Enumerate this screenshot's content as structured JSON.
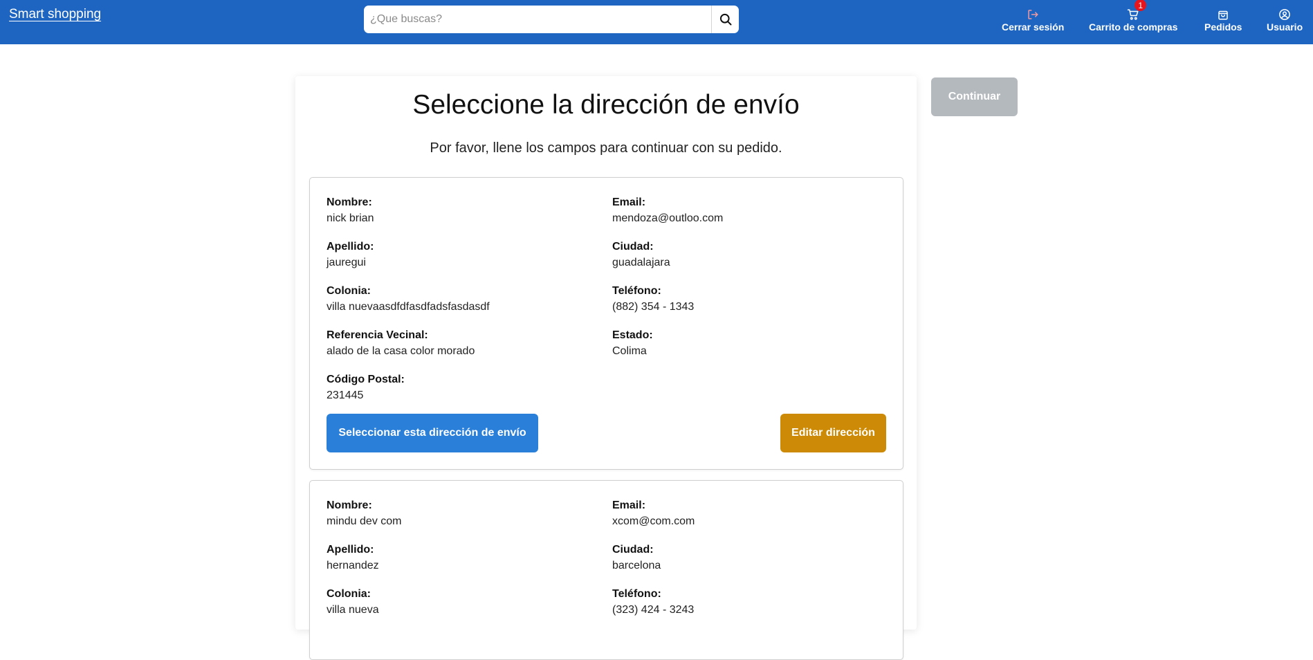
{
  "header": {
    "brand": "Smart shopping",
    "search": {
      "placeholder": "¿Que buscas?",
      "value": ""
    },
    "nav": {
      "logout": "Cerrar sesión",
      "cart": "Carrito de compras",
      "cart_count": "1",
      "orders": "Pedidos",
      "user": "Usuario"
    }
  },
  "page": {
    "title": "Seleccione la dirección de envío",
    "subtitle": "Por favor, llene los campos para continuar con su pedido.",
    "continue_label": "Continuar"
  },
  "addresses": [
    {
      "nombre": {
        "label": "Nombre:",
        "value": "nick brian"
      },
      "apellido": {
        "label": "Apellido:",
        "value": "jauregui"
      },
      "colonia": {
        "label": "Colonia:",
        "value": "villa nuevaasdfdfasdfadsfasdasdf"
      },
      "referencia": {
        "label": "Referencia Vecinal:",
        "value": "alado de la casa color morado"
      },
      "codigo_postal": {
        "label": "Código Postal:",
        "value": "231445"
      },
      "email": {
        "label": "Email:",
        "value": "mendoza@outloo.com"
      },
      "ciudad": {
        "label": "Ciudad:",
        "value": "guadalajara"
      },
      "telefono": {
        "label": "Teléfono:",
        "value": "(882) 354 - 1343"
      },
      "estado": {
        "label": "Estado:",
        "value": "Colima"
      },
      "select_label": "Seleccionar esta dirección de envío",
      "edit_label": "Editar dirección"
    },
    {
      "nombre": {
        "label": "Nombre:",
        "value": "mindu dev com"
      },
      "apellido": {
        "label": "Apellido:",
        "value": "hernandez"
      },
      "colonia": {
        "label": "Colonia:",
        "value": "villa nueva"
      },
      "email": {
        "label": "Email:",
        "value": "xcom@com.com"
      },
      "ciudad": {
        "label": "Ciudad:",
        "value": "barcelona"
      },
      "telefono": {
        "label": "Teléfono:",
        "value": "(323) 424 - 3243"
      }
    }
  ],
  "colors": {
    "header_bg": "#1d65c1",
    "select_button": "#2a7fd9",
    "edit_button": "#cc8a06",
    "continue_disabled": "#b4b9bd",
    "badge": "#e5141d",
    "logout_icon": "#f29aa0"
  },
  "icons": {
    "search": "search-icon",
    "logout": "logout-icon",
    "cart": "cart-icon",
    "orders": "shopping-bag-icon",
    "user": "user-circle-icon"
  }
}
